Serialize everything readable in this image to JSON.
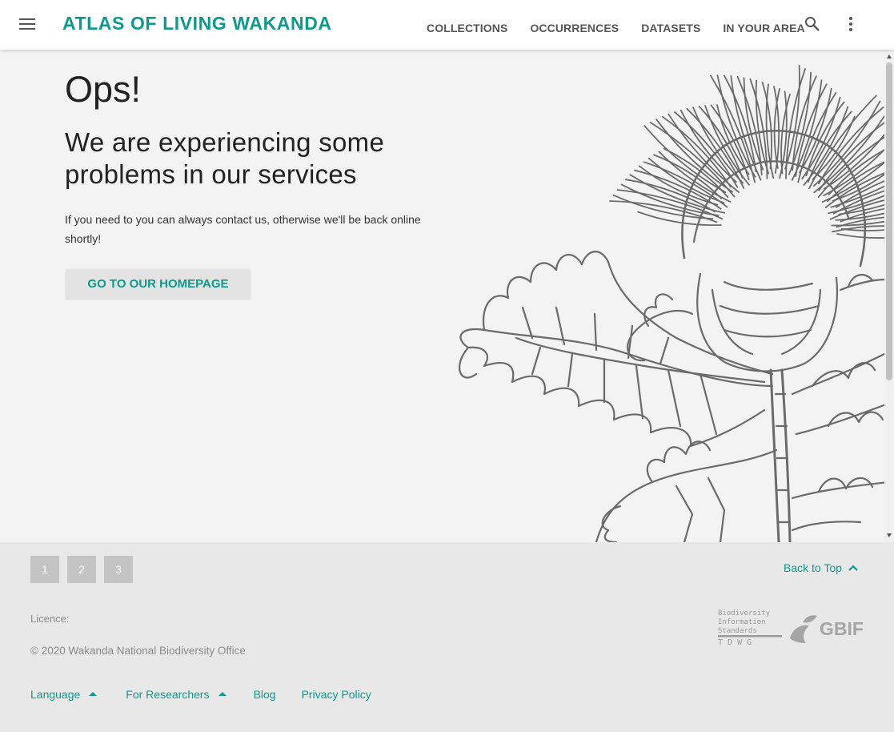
{
  "header": {
    "brand": "ATLAS OF LIVING WAKANDA",
    "nav": [
      "COLLECTIONS",
      "OCCURRENCES",
      "DATASETS",
      "IN YOUR AREA"
    ],
    "icons": [
      "menu-icon",
      "search-icon",
      "more-vert-icon"
    ]
  },
  "main": {
    "title": "Ops!",
    "subtitle": "We are experiencing some problems in our services",
    "message": "If you need to you can always contact us, otherwise we'll be back online shortly!",
    "button_label": "GO TO OUR HOMEPAGE",
    "illustration": "thistle-illustration"
  },
  "footer": {
    "pages": [
      "1",
      "2",
      "3"
    ],
    "back_to_top": "Back to Top",
    "licence": "Licence:",
    "copyright": "© 2020 Wakanda National Biodiversity Office",
    "links": {
      "language": "Language",
      "researchers": "For Researchers",
      "blog": "Blog",
      "privacy": "Privacy Policy"
    },
    "logos": {
      "tdwg_lines": [
        "Biodiversity",
        "Information",
        "Standards",
        "T D W G"
      ],
      "gbif": "GBIF"
    }
  },
  "colors": {
    "accent": "#0d9a8a",
    "header_bg": "#ffffff",
    "page_bg": "#f3f3f3",
    "footer_bg": "#e8e8e8",
    "pager_bg": "#c4c4c4",
    "muted_text": "#8a8a8a"
  }
}
